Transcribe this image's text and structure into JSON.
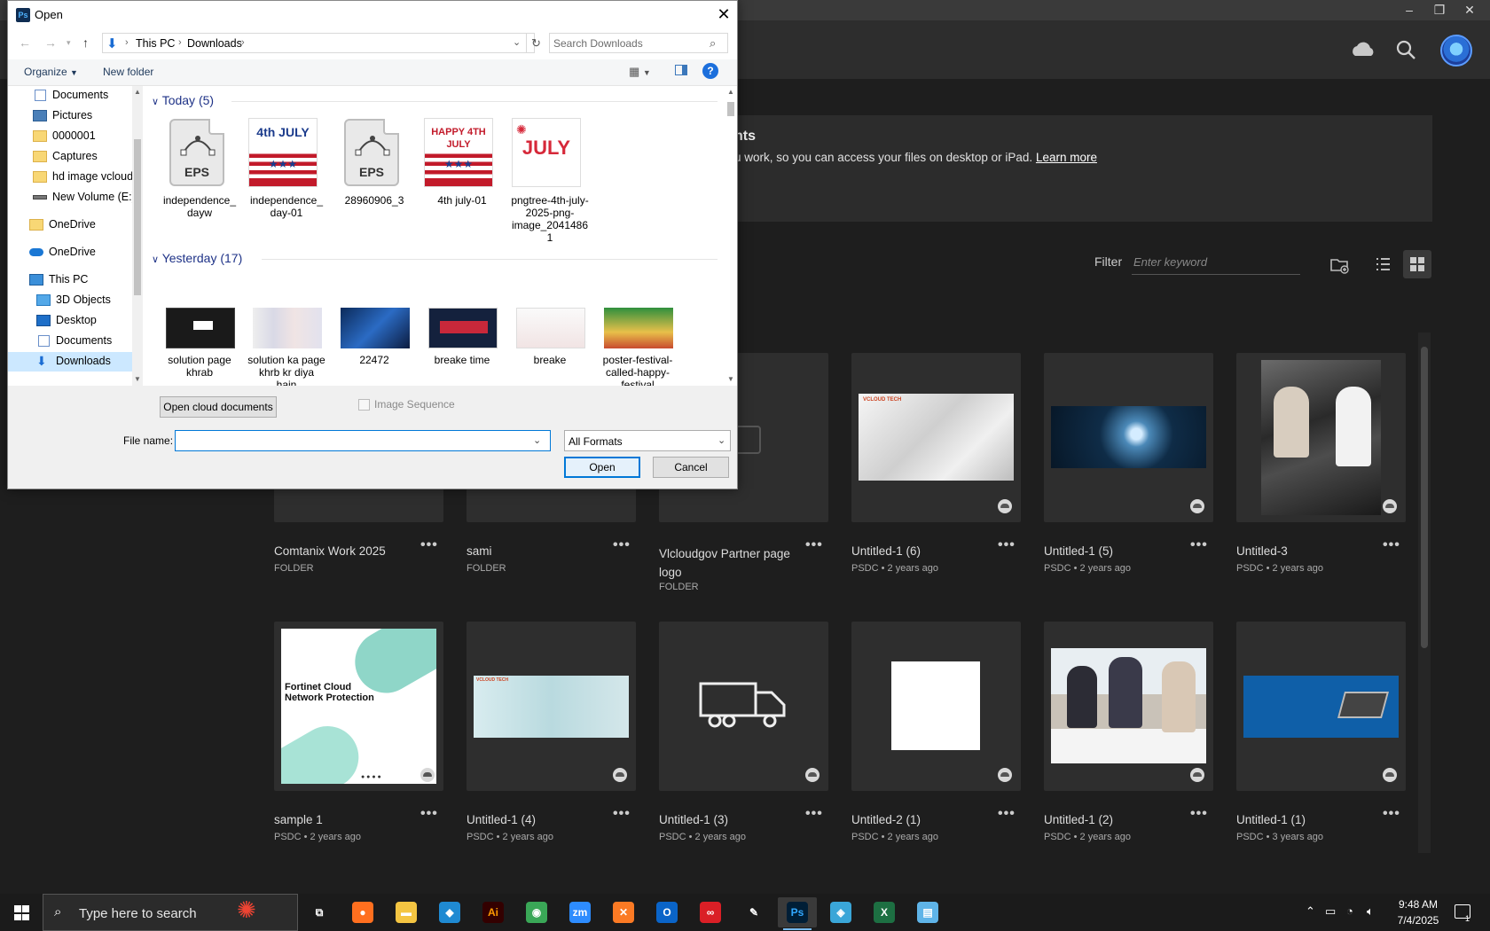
{
  "dialog": {
    "title": "Open",
    "app_icon": "Ps",
    "close_icon": "close-icon",
    "breadcrumb": [
      "This PC",
      "Downloads"
    ],
    "search_placeholder": "Search Downloads",
    "toolbar": {
      "organize": "Organize",
      "new_folder": "New folder",
      "help": "?"
    },
    "nav_items": [
      {
        "label": "Documents",
        "pinned": true,
        "icon": "documents-icon"
      },
      {
        "label": "Pictures",
        "pinned": true,
        "icon": "pictures-icon"
      },
      {
        "label": "0000001",
        "icon": "folder-icon"
      },
      {
        "label": "Captures",
        "icon": "folder-icon"
      },
      {
        "label": "hd image vcloud",
        "icon": "folder-icon"
      },
      {
        "label": "New Volume (E:)",
        "icon": "drive-icon"
      },
      {
        "label": "OneDrive",
        "icon": "folder-icon"
      },
      {
        "label": "OneDrive",
        "icon": "onedrive-icon"
      },
      {
        "label": "This PC",
        "icon": "pc-icon"
      },
      {
        "label": "3D Objects",
        "icon": "3d-objects-icon"
      },
      {
        "label": "Desktop",
        "icon": "desktop-icon"
      },
      {
        "label": "Documents",
        "icon": "documents-icon"
      },
      {
        "label": "Downloads",
        "icon": "downloads-icon",
        "selected": true
      }
    ],
    "groups": [
      {
        "header": "Today (5)",
        "files": [
          {
            "name": "independence_dayw",
            "thumb": "eps",
            "thumb_label": "EPS"
          },
          {
            "name": "independence_day-01",
            "thumb": "july",
            "thumb_text": "4th JULY"
          },
          {
            "name": "28960906_3",
            "thumb": "eps",
            "thumb_label": "EPS"
          },
          {
            "name": "4th july-01",
            "thumb": "july",
            "thumb_text": "HAPPY 4TH JULY"
          },
          {
            "name": "pngtree-4th-july-2025-png-image_20414861",
            "thumb": "july2",
            "thumb_text": "JULY"
          }
        ]
      },
      {
        "header": "Yesterday (17)",
        "files": [
          {
            "name": "solution page khrab",
            "thumb": "dark"
          },
          {
            "name": "solution ka page khrb kr diya hain",
            "thumb": "collage"
          },
          {
            "name": "22472",
            "thumb": "blue"
          },
          {
            "name": "breake time",
            "thumb": "red"
          },
          {
            "name": "breake",
            "thumb": "light"
          },
          {
            "name": "poster-festival-called-happy-festival",
            "thumb": "festival"
          }
        ]
      }
    ],
    "open_cloud_docs": "Open cloud documents",
    "image_sequence": "Image Sequence",
    "file_name_label": "File name:",
    "file_name_value": "",
    "format_value": "All Formats",
    "open_button": "Open",
    "cancel_button": "Cancel"
  },
  "photoshop": {
    "banner_title": "nts",
    "banner_text": "u work, so you can access your files on desktop or iPad.",
    "banner_link": "Learn more",
    "filter_label": "Filter",
    "filter_placeholder": "Enter keyword",
    "cards": [
      {
        "title": "Comtanix Work 2025",
        "meta": "FOLDER"
      },
      {
        "title": "sami",
        "meta": "FOLDER"
      },
      {
        "title": "Vlcloudgov Partner page logo",
        "meta": "FOLDER"
      },
      {
        "title": "Untitled-1 (6)",
        "meta": "PSDC • 2 years ago",
        "thumb": "tech"
      },
      {
        "title": "Untitled-1 (5)",
        "meta": "PSDC • 2 years ago",
        "thumb": "brain"
      },
      {
        "title": "Untitled-3",
        "meta": "PSDC • 2 years ago",
        "thumb": "people"
      },
      {
        "title": "sample 1",
        "meta": "PSDC • 2 years ago",
        "thumb": "fortinet",
        "thumb_text": "Fortinet Cloud Network Protection"
      },
      {
        "title": "Untitled-1 (4)",
        "meta": "PSDC • 2 years ago",
        "thumb": "pale"
      },
      {
        "title": "Untitled-1 (3)",
        "meta": "PSDC • 2 years ago",
        "thumb": "truck"
      },
      {
        "title": "Untitled-2 (1)",
        "meta": "PSDC • 2 years ago",
        "thumb": "white"
      },
      {
        "title": "Untitled-1 (2)",
        "meta": "PSDC • 2 years ago",
        "thumb": "office"
      },
      {
        "title": "Untitled-1 (1)",
        "meta": "PSDC • 3 years ago",
        "thumb": "laptop"
      }
    ]
  },
  "taskbar": {
    "search_text": "Type here to search",
    "apps": [
      {
        "name": "task-view",
        "glyph": "⧉",
        "color": "transparent"
      },
      {
        "name": "firefox",
        "glyph": "●",
        "color": "#ff6f1f"
      },
      {
        "name": "file-explorer",
        "glyph": "▬",
        "color": "#f4c542"
      },
      {
        "name": "vscode",
        "glyph": "◆",
        "color": "#1f8ad2"
      },
      {
        "name": "illustrator",
        "glyph": "Ai",
        "color": "#330000"
      },
      {
        "name": "chrome",
        "glyph": "◉",
        "color": "#3aa757"
      },
      {
        "name": "zoom",
        "glyph": "zm",
        "color": "#2d8cff"
      },
      {
        "name": "xampp",
        "glyph": "✕",
        "color": "#fb7a24"
      },
      {
        "name": "outlook",
        "glyph": "O",
        "color": "#0a64c8"
      },
      {
        "name": "creative-cloud",
        "glyph": "∞",
        "color": "#da1f26"
      },
      {
        "name": "pen-tool",
        "glyph": "✎",
        "color": "transparent"
      },
      {
        "name": "photoshop",
        "glyph": "Ps",
        "color": "#001e36"
      },
      {
        "name": "app-blue",
        "glyph": "◈",
        "color": "#3aa6d8"
      },
      {
        "name": "excel",
        "glyph": "X",
        "color": "#1d6f42"
      },
      {
        "name": "notepad",
        "glyph": "▤",
        "color": "#5fb4e8"
      }
    ],
    "time": "9:48 AM",
    "date": "7/4/2025",
    "notification_count": "1"
  }
}
